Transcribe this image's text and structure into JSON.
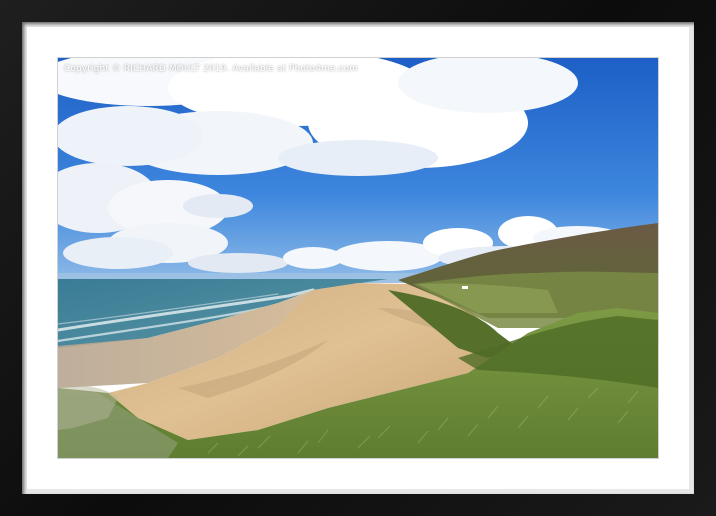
{
  "image": {
    "kind": "framed print mockup",
    "frame_color": "#121212",
    "mount_color": "#ffffff",
    "scene": "coastal bay with long sandy beach, green headland and blue sky with white clouds"
  },
  "watermark": {
    "text": "Copyright  © RICHARD MOULT  2019. Available at Photo4me.com"
  },
  "colors": {
    "sky_top": "#1f63c9",
    "sky_bottom": "#7fb0e6",
    "sea": "#3e7f97",
    "sand": "#d9b98a",
    "grass": "#6f8f3c",
    "hill": "#6b5640"
  }
}
